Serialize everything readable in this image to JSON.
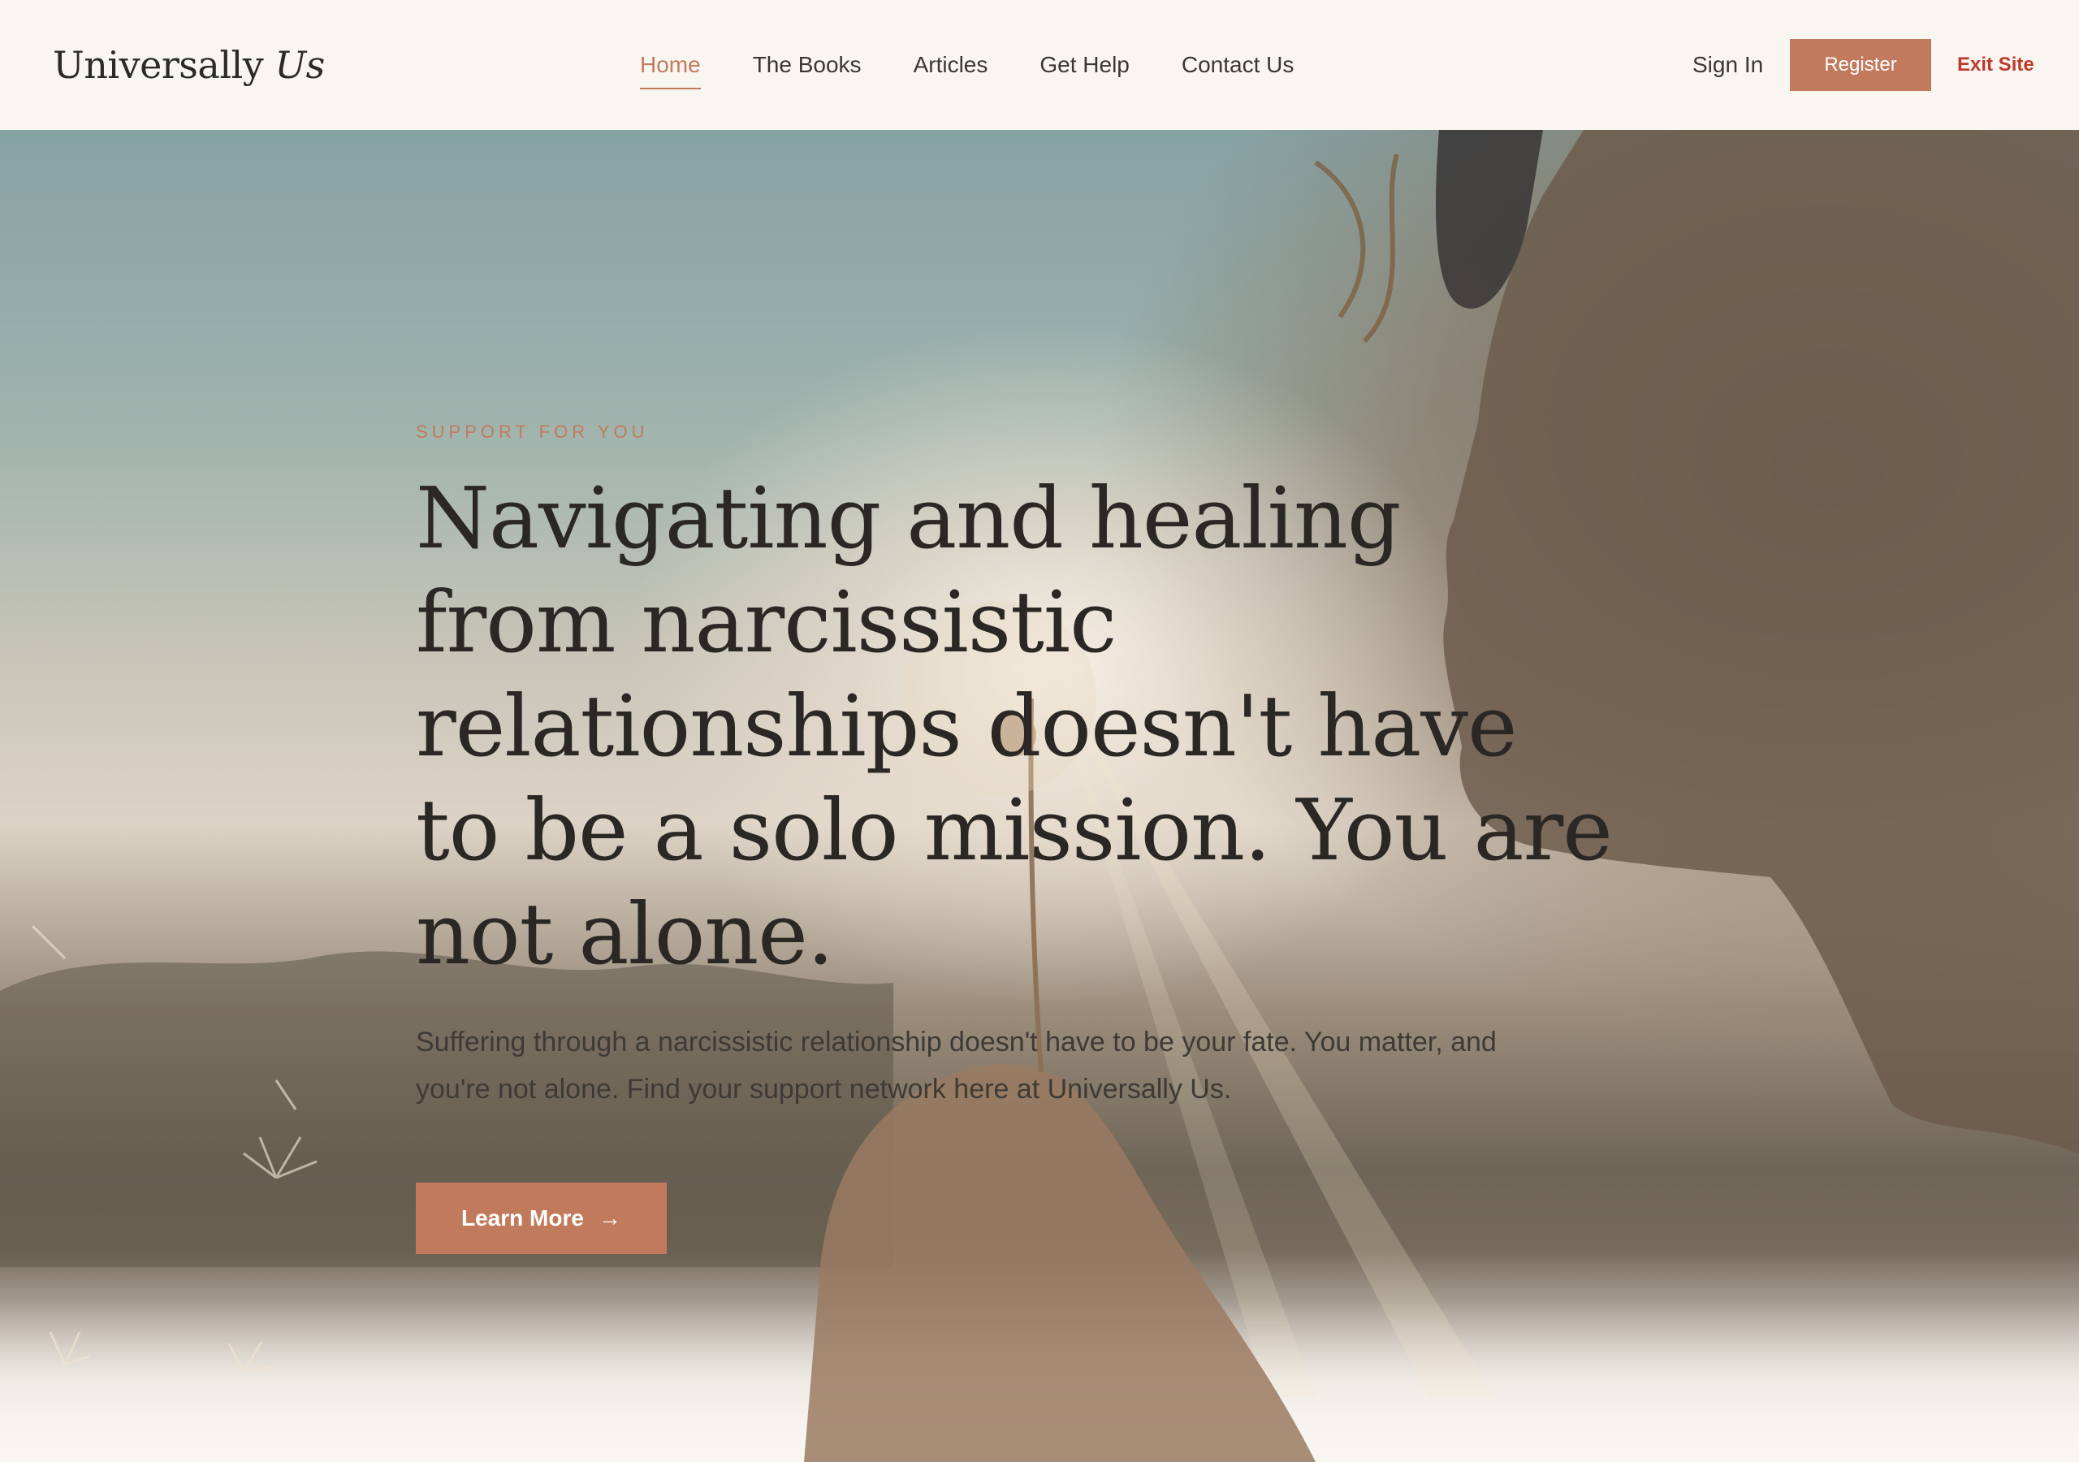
{
  "brand": {
    "name": "Universally",
    "accent": "Us"
  },
  "nav": {
    "items": [
      {
        "label": "Home",
        "active": true
      },
      {
        "label": "The Books",
        "active": false
      },
      {
        "label": "Articles",
        "active": false
      },
      {
        "label": "Get Help",
        "active": false
      },
      {
        "label": "Contact Us",
        "active": false
      }
    ]
  },
  "header_actions": {
    "sign_in": "Sign In",
    "register": "Register",
    "exit_site": "Exit Site"
  },
  "hero": {
    "eyebrow": "SUPPORT FOR YOU",
    "headline": "Navigating and healing from narcissistic relationships doesn't have to be a solo mission. You are not alone.",
    "subtext": "Suffering through a narcissistic relationship doesn't have to be your fate. You matter, and you're not alone. Find your support network here at Universally Us.",
    "cta_label": "Learn More",
    "cta_icon": "arrow-right-icon"
  },
  "colors": {
    "accent": "#c27a5d",
    "exit": "#c0392b",
    "text": "#2a2725",
    "background": "#f9f5f1"
  }
}
